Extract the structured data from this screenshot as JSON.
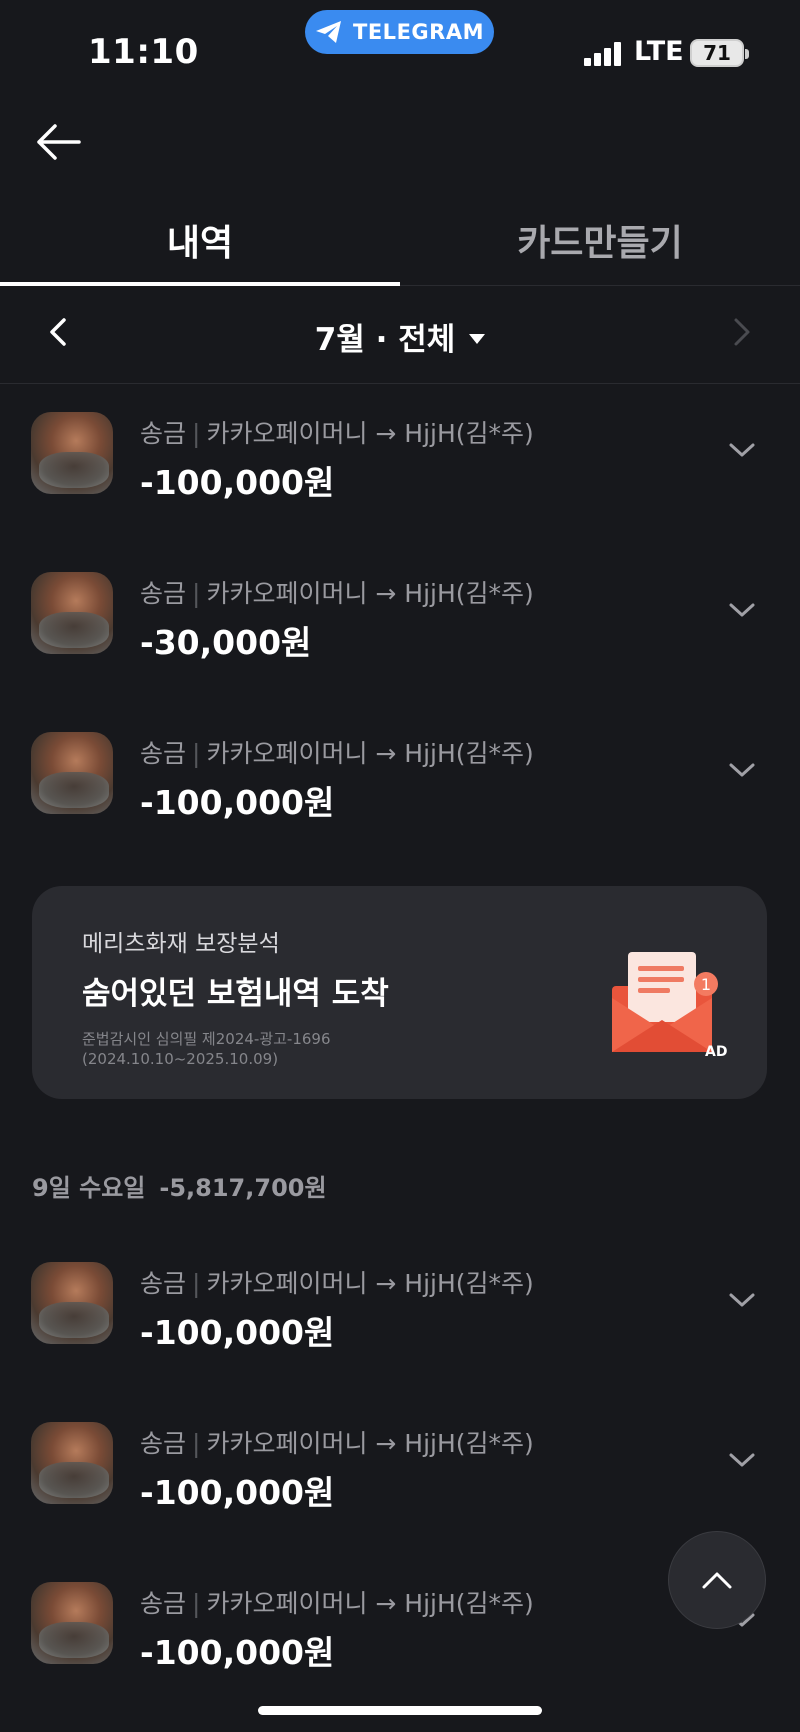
{
  "status_bar": {
    "time": "11:10",
    "app_pill": "TELEGRAM",
    "network": "LTE",
    "battery": "71"
  },
  "tabs": [
    {
      "label": "내역",
      "active": true
    },
    {
      "label": "카드만들기",
      "active": false
    }
  ],
  "month_selector": {
    "label": "7월 · 전체"
  },
  "transactions_top": [
    {
      "type": "송금",
      "desc": "카카오페이머니 → HjjH(김*주)",
      "amount": "-100,000원"
    },
    {
      "type": "송금",
      "desc": "카카오페이머니 → HjjH(김*주)",
      "amount": "-30,000원"
    },
    {
      "type": "송금",
      "desc": "카카오페이머니 → HjjH(김*주)",
      "amount": "-100,000원"
    }
  ],
  "ad": {
    "subtitle": "메리츠화재 보장분석",
    "title": "숨어있던 보험내역 도착",
    "note_line1": "준법감시인 심의필 제2024-광고-1696",
    "note_line2": "(2024.10.10~2025.10.09)",
    "badge": "AD",
    "icon_count": "1"
  },
  "day_group": {
    "label": "9일 수요일",
    "total": "-5,817,700원"
  },
  "transactions_day": [
    {
      "type": "송금",
      "desc": "카카오페이머니 → HjjH(김*주)",
      "amount": "-100,000원"
    },
    {
      "type": "송금",
      "desc": "카카오페이머니 → HjjH(김*주)",
      "amount": "-100,000원"
    },
    {
      "type": "송금",
      "desc": "카카오페이머니 → HjjH(김*주)",
      "amount": "-100,000원"
    }
  ],
  "colors": {
    "background": "#17181c",
    "card": "#2a2b30",
    "telegram_blue": "#3a8bf0",
    "envelope_red": "#e9553c"
  }
}
